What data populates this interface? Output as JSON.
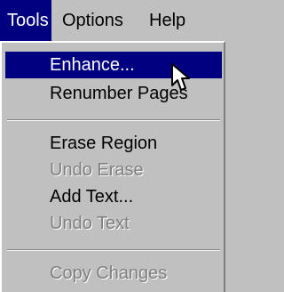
{
  "menubar": {
    "items": [
      {
        "label": "Tools"
      },
      {
        "label": "Options"
      },
      {
        "label": "Help"
      }
    ]
  },
  "menu": {
    "items": [
      {
        "label": "Enhance...",
        "state": "highlighted"
      },
      {
        "label": "Renumber Pages",
        "state": "enabled"
      },
      {
        "label": "Erase Region",
        "state": "enabled"
      },
      {
        "label": "Undo Erase",
        "state": "disabled"
      },
      {
        "label": "Add Text...",
        "state": "enabled"
      },
      {
        "label": "Undo Text",
        "state": "disabled"
      },
      {
        "label": "Copy Changes",
        "state": "disabled"
      }
    ]
  },
  "colors": {
    "highlight": "#000080",
    "face": "#c0c0c0",
    "disabled_text": "#808080"
  }
}
